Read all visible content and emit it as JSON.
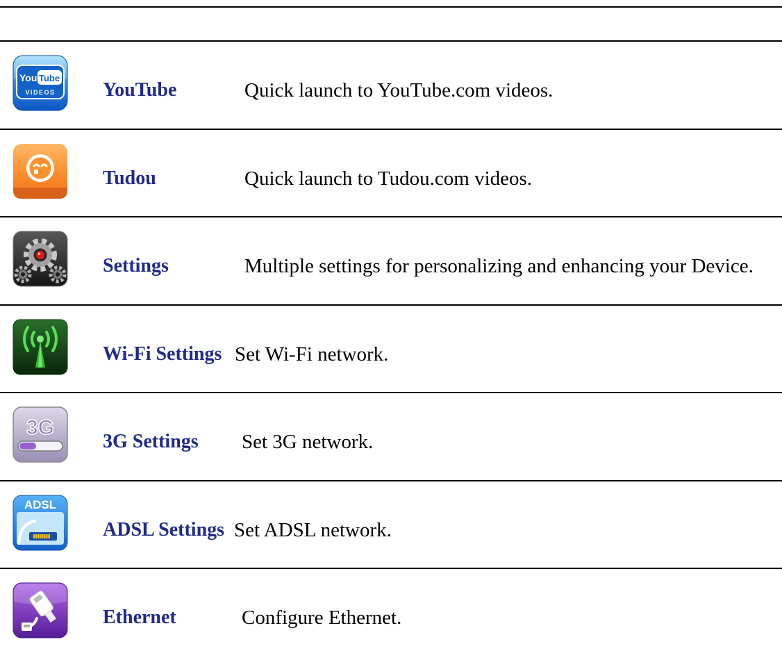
{
  "rows": [
    {
      "icon": "youtube-icon",
      "name": "YouTube",
      "description": "Quick launch to YouTube.com videos."
    },
    {
      "icon": "tudou-icon",
      "name": "Tudou",
      "description": "Quick launch to Tudou.com videos."
    },
    {
      "icon": "settings-gear-icon",
      "name": "Settings",
      "description": "Multiple settings for personalizing and enhancing your Device."
    },
    {
      "icon": "wifi-antenna-icon",
      "name": "Wi-Fi Settings",
      "description": "Set Wi-Fi network."
    },
    {
      "icon": "3g-icon",
      "name": "3G Settings",
      "description": "Set 3G network."
    },
    {
      "icon": "adsl-modem-icon",
      "name": "ADSL Settings",
      "description": "Set ADSL network."
    },
    {
      "icon": "ethernet-plug-icon",
      "name": "Ethernet",
      "description": "Configure Ethernet."
    }
  ],
  "icon_lettering": {
    "youtube": {
      "you": "You",
      "tube": "Tube",
      "videos": "VIDEOS"
    },
    "threeg": "3G",
    "adsl": "ADSL"
  },
  "colors": {
    "app_name": "#1f2a8c",
    "description": "#000000",
    "rule": "#000000"
  }
}
